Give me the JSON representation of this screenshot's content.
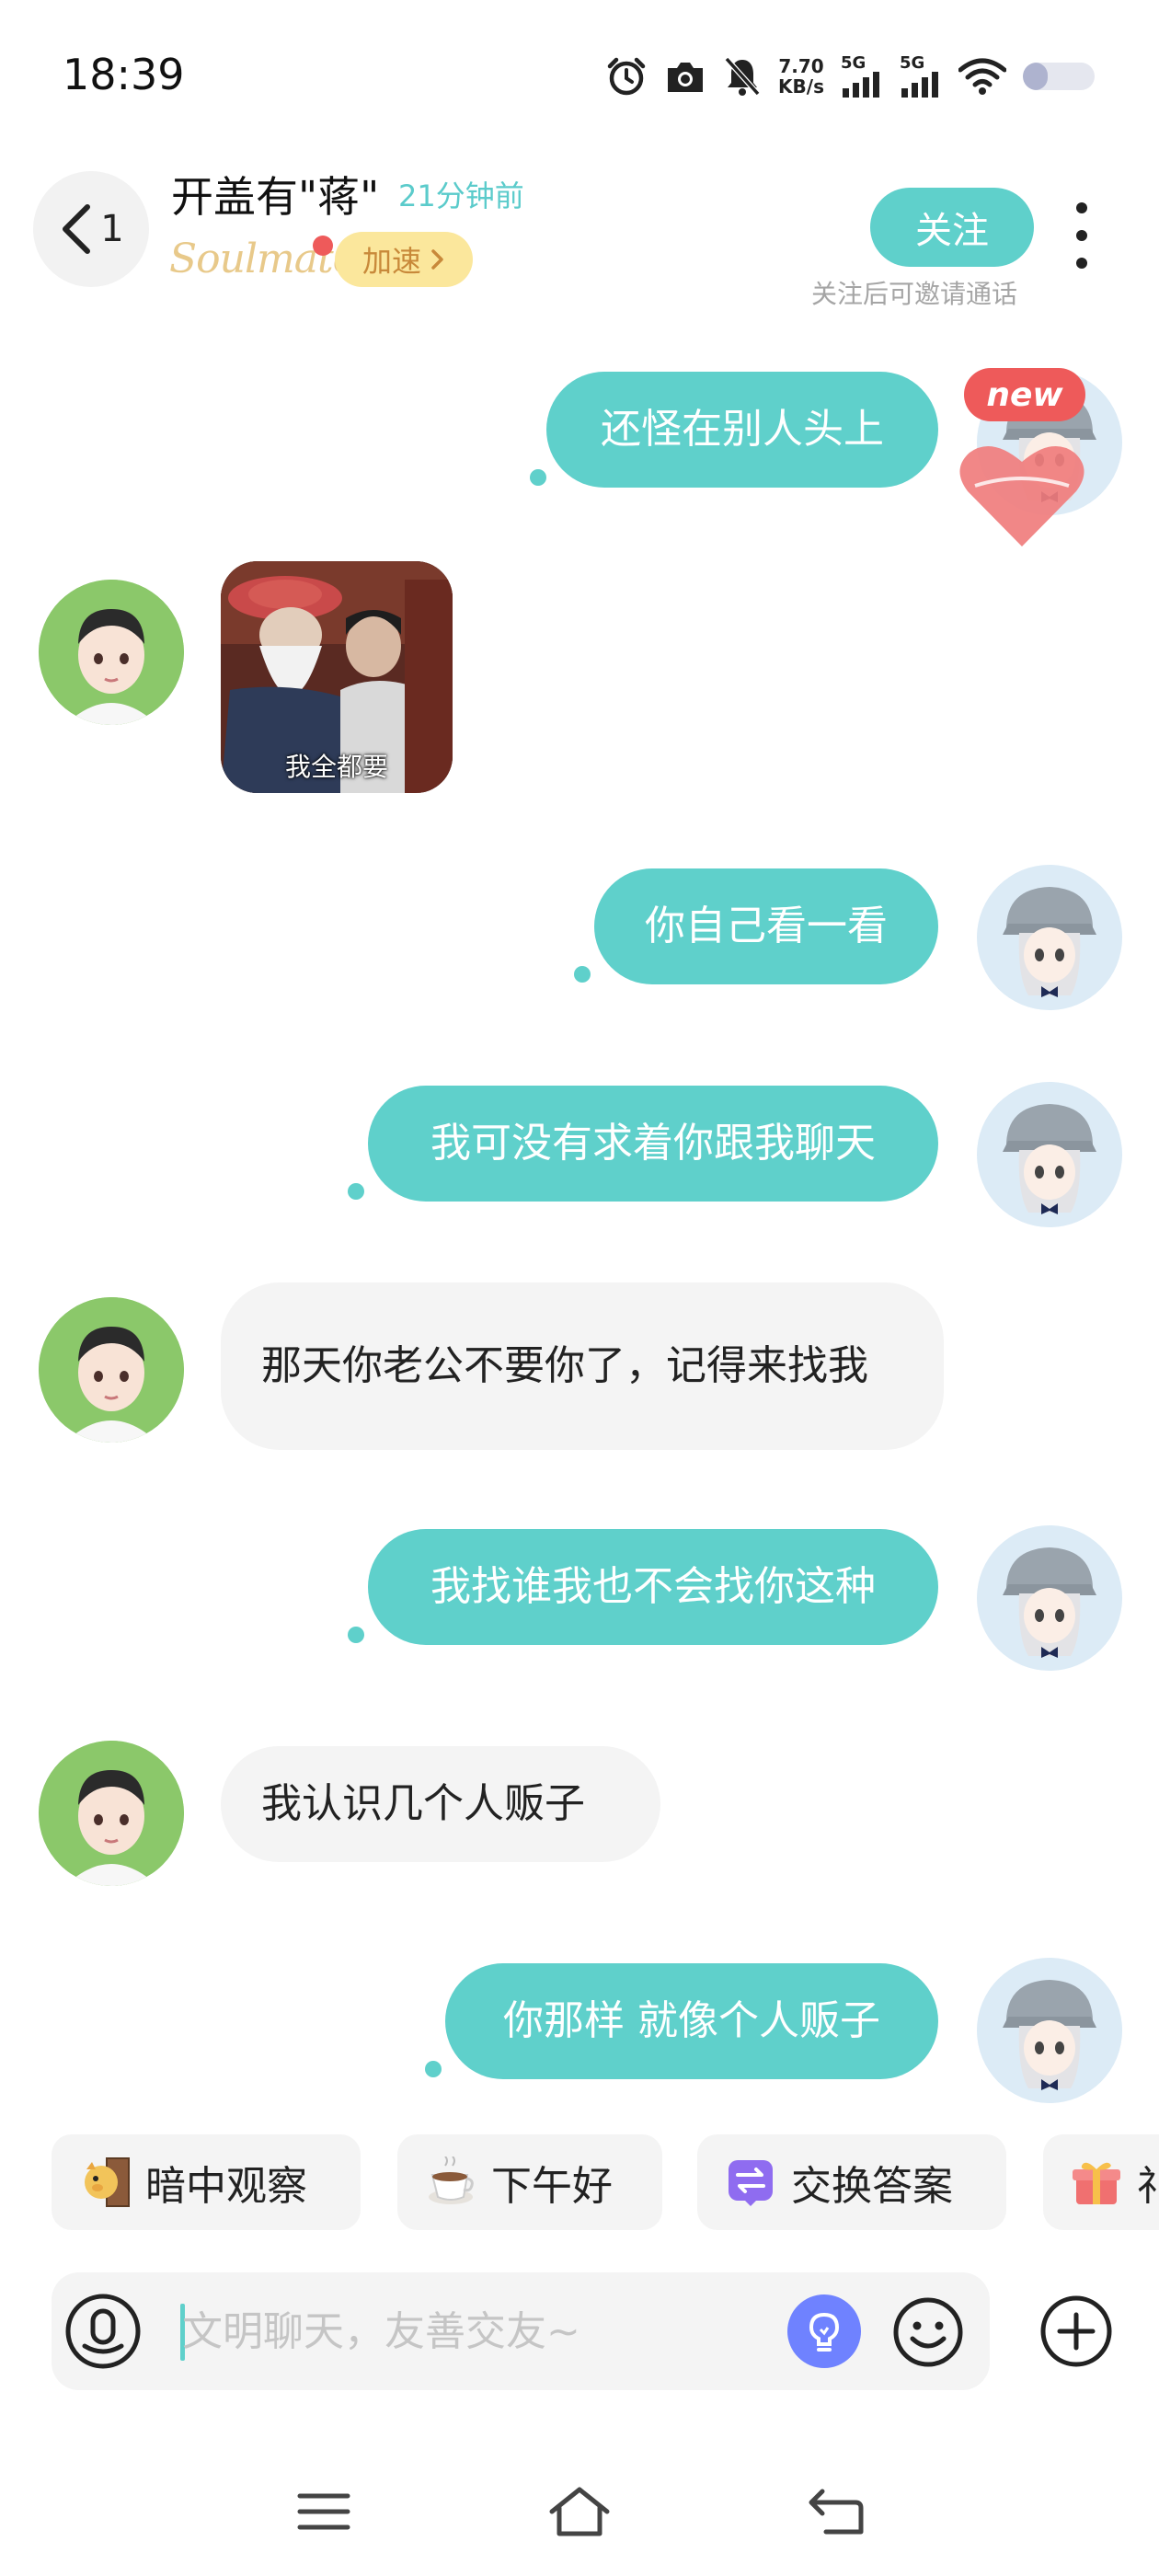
{
  "status_bar": {
    "time": "18:39",
    "net_speed_value": "7.70",
    "net_speed_unit": "KB/s",
    "sim1_label": "5G",
    "sim2_label": "5G",
    "battery_level": 0.35
  },
  "header": {
    "unread_count": "1",
    "peer_name": "开盖有\"蒋\"",
    "last_seen": "21分钟前",
    "soulmate_label": "Soulmate",
    "boost_label": "加速",
    "follow_label": "关注",
    "follow_hint": "关注后可邀请通话"
  },
  "messages": [
    {
      "from": "me",
      "text": "还怪在别人头上",
      "badge": "new"
    },
    {
      "from": "peer",
      "type": "sticker",
      "caption": "我全都要"
    },
    {
      "from": "me",
      "text": "你自己看一看"
    },
    {
      "from": "me",
      "text": "我可没有求着你跟我聊天"
    },
    {
      "from": "peer",
      "text": "那天你老公不要你了，记得来找我"
    },
    {
      "from": "me",
      "text": "我找谁我也不会找你这种"
    },
    {
      "from": "peer",
      "text": "我认识几个人贩子"
    },
    {
      "from": "me",
      "text": "你那样 就像个人贩子"
    }
  ],
  "quick_replies": [
    {
      "label": "暗中观察",
      "icon": "peeking-dog-icon"
    },
    {
      "label": "下午好",
      "icon": "coffee-cup-icon"
    },
    {
      "label": "交换答案",
      "icon": "exchange-icon"
    },
    {
      "label": "礼",
      "icon": "gift-icon"
    }
  ],
  "input": {
    "placeholder": "文明聊天，友善交友~"
  },
  "colors": {
    "accent": "#5fd0cb",
    "peer_bubble": "#f4f4f4",
    "badge_red": "#ee5a5a",
    "boost_bg": "#fbe79c"
  }
}
